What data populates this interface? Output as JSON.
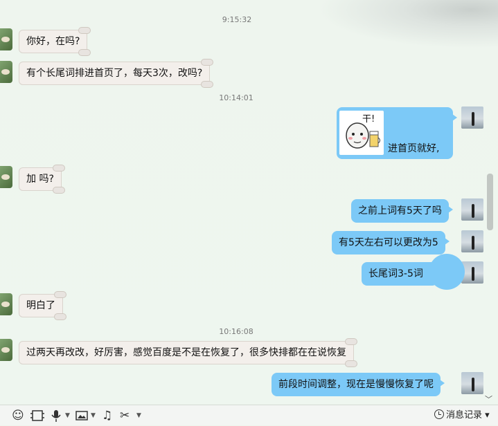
{
  "messages": [
    {
      "type": "time",
      "text": "9:15:32"
    },
    {
      "type": "in",
      "text": "你好，在吗?"
    },
    {
      "type": "in",
      "text": "有个长尾词排进首页了，每天3次，改吗?"
    },
    {
      "type": "time",
      "text": "10:14:01"
    },
    {
      "type": "out",
      "sticker_text": "干!",
      "text": "进首页就好,"
    },
    {
      "type": "in",
      "text": "加 吗?"
    },
    {
      "type": "out",
      "text": "之前上词有5天了吗"
    },
    {
      "type": "out",
      "text": "有5天左右可以更改为5"
    },
    {
      "type": "out",
      "text": "长尾词3-5词"
    },
    {
      "type": "in",
      "text": "明白了"
    },
    {
      "type": "time",
      "text": "10:16:08"
    },
    {
      "type": "in",
      "text": "过两天再改改，好厉害，感觉百度是不是在恢复了，很多快排都在在说恢复"
    },
    {
      "type": "out",
      "text": "前段时间调整，现在是慢慢恢复了呢"
    }
  ],
  "toolbar": {
    "icons": [
      "emoji-icon",
      "screenshot-icon",
      "voice-icon",
      "image-icon",
      "music-icon",
      "scissors-icon"
    ],
    "history_label": "消息记录",
    "history_caret": "▾"
  },
  "colors": {
    "outgoing_bubble": "#7cc9f7",
    "incoming_bubble": "#f3efeb",
    "background": "#eef5ec"
  }
}
